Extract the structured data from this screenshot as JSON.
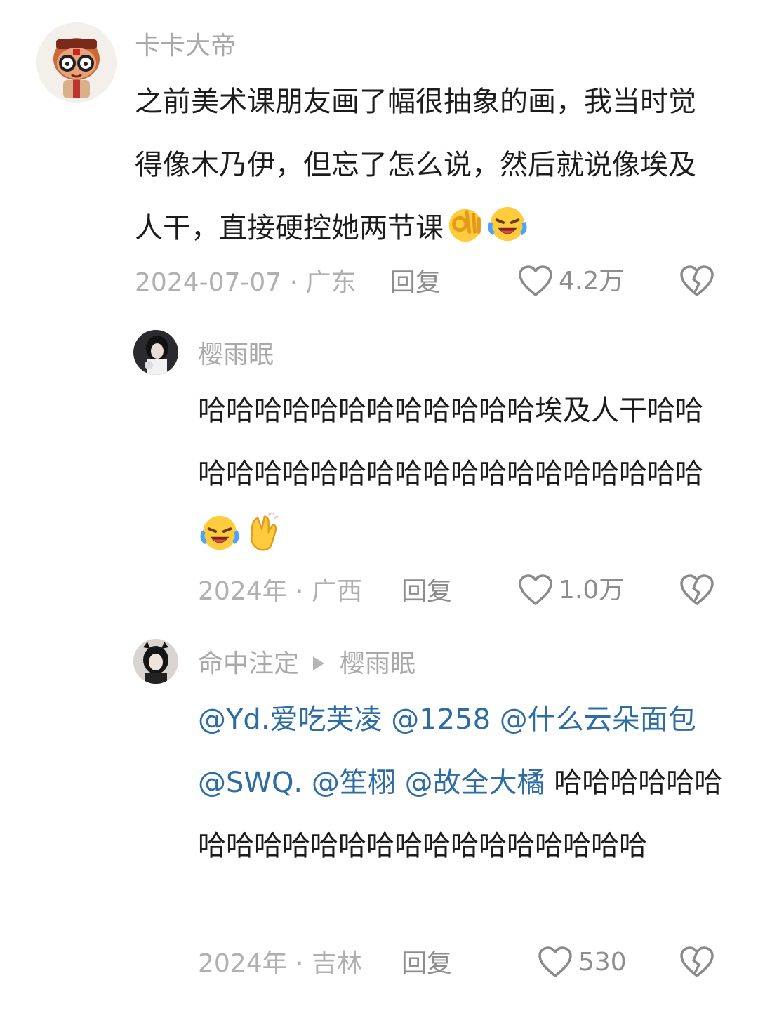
{
  "comments": [
    {
      "username": "卡卡大帝",
      "text": "之前美术课朋友画了幅很抽象的画，我当时觉得像木乃伊，但忘了怎么说，然后就说像埃及人干，直接硬控她两节课",
      "emojis": [
        "ok-hand-emoji",
        "laughing-crying-emoji"
      ],
      "date_location": "2024-07-07 · 广东",
      "reply_label": "回复",
      "likes": "4.2万",
      "avatar": "cartoon-avatar"
    },
    {
      "username": "樱雨眠",
      "text": "哈哈哈哈哈哈哈哈哈哈哈哈埃及人干哈哈哈哈哈哈哈哈哈哈哈哈哈哈哈哈哈哈哈哈",
      "emojis": [
        "laughing-crying-emoji",
        "clapping-hand-emoji"
      ],
      "date_location": "2024年 · 广西",
      "reply_label": "回复",
      "likes": "1.0万",
      "avatar": "photo-avatar"
    },
    {
      "username": "命中注定",
      "reply_to": "樱雨眠",
      "mentions": "@Yd.爱吃芙凌 @1258 @什么云朵面包 @SWQ. @笙栩 @故全大橘",
      "text": " 哈哈哈哈哈哈哈哈哈哈哈哈哈哈哈哈哈哈哈哈哈哈",
      "date_location": "2024年 · 吉林",
      "reply_label": "回复",
      "likes": "530",
      "avatar": "photo-avatar"
    }
  ],
  "colors": {
    "username": "#a9a9a9",
    "mention": "#2e6da4",
    "meta": "#b0b0b0"
  }
}
